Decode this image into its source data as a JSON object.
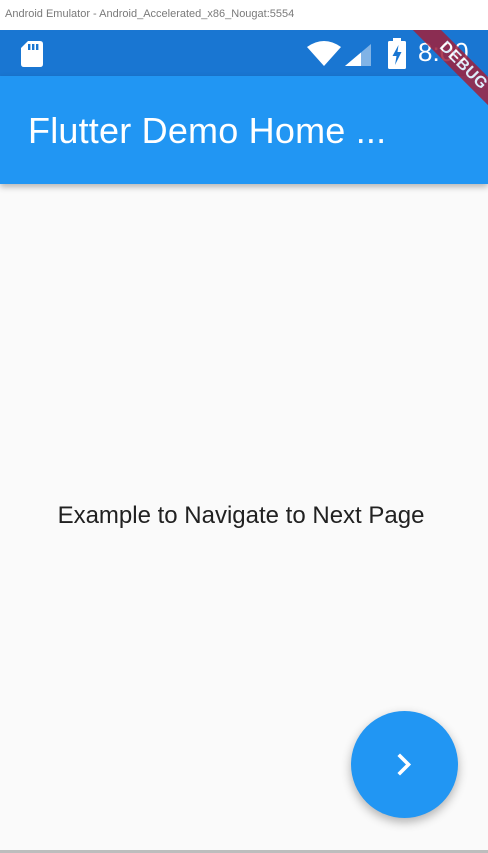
{
  "window": {
    "title": "Android Emulator - Android_Accelerated_x86_Nougat:5554"
  },
  "status_bar": {
    "time": "8:00",
    "color": "#1976d2",
    "icons": [
      "sd-card-icon",
      "wifi-icon",
      "signal-icon",
      "battery-charging-icon"
    ]
  },
  "debug_banner": {
    "label": "DEBUG",
    "color": "#a0213c"
  },
  "app_bar": {
    "title": "Flutter Demo Home ...",
    "color": "#2196f3"
  },
  "main": {
    "text": "Example to Navigate to Next Page"
  },
  "fab": {
    "icon": "chevron-right-icon",
    "color": "#2196f3"
  }
}
